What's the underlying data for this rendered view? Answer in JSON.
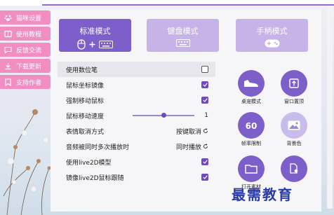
{
  "sidebar": {
    "items": [
      {
        "label": "猫咪设置",
        "icon": "paw-icon"
      },
      {
        "label": "使用教程",
        "icon": "book-icon"
      },
      {
        "label": "反馈交流",
        "icon": "chat-icon"
      },
      {
        "label": "下载更新",
        "icon": "download-icon"
      },
      {
        "label": "支持作者",
        "icon": "heart-bookmark-icon"
      }
    ]
  },
  "modes": [
    {
      "label": "标准模式",
      "active": true
    },
    {
      "label": "键盘模式",
      "active": false
    },
    {
      "label": "手柄模式",
      "active": false
    }
  ],
  "settings": {
    "use_pen": {
      "label": "使用数位笔",
      "checked": false
    },
    "mouse_mirror": {
      "label": "鼠标坐标镜像",
      "checked": true
    },
    "force_mouse": {
      "label": "强制移动鼠标",
      "checked": true
    },
    "mouse_speed": {
      "label": "鼠标移动速度",
      "value": "1",
      "fraction": 0.5
    },
    "expression_cancel": {
      "label": "表情取消方式",
      "value": "按键取消"
    },
    "audio_overlap": {
      "label": "音频被同时多次播放时",
      "value": "同时播放"
    },
    "live2d": {
      "label": "使用live2D模型",
      "checked": true
    },
    "live2d_mirror": {
      "label": "镜像live2D鼠标跟随",
      "checked": true
    }
  },
  "tools": [
    {
      "label": "桌宠模式",
      "icon": "shoe-icon"
    },
    {
      "label": "窗口置顶",
      "icon": "pin-top-icon"
    },
    {
      "label": "帧率限制",
      "icon": "fps-60-icon"
    },
    {
      "label": "背景色",
      "icon": "landscape-icon"
    },
    {
      "label": "打开素材",
      "icon": "folder-icon"
    },
    {
      "label": "",
      "icon": "file-settings-icon"
    }
  ],
  "watermark": "最需教育",
  "colors": {
    "accent": "#7d5fc9",
    "accent_light": "#c6b3e8",
    "sidebar": "#f08ec2"
  }
}
